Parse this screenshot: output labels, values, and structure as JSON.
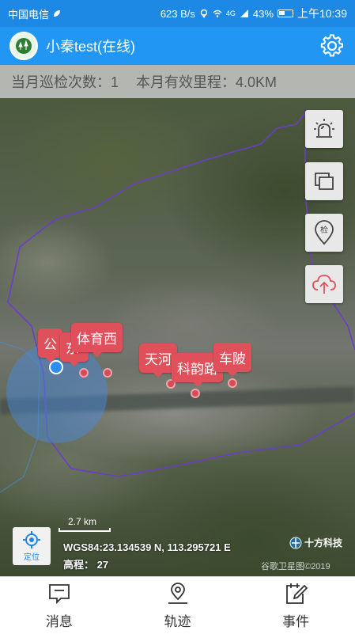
{
  "status_bar": {
    "carrier": "中国电信",
    "speed": "623 B/s",
    "network": "4G",
    "battery": "43%",
    "time": "上午10:39"
  },
  "app_bar": {
    "title": "小秦test(在线)",
    "settings_icon": "gear-icon"
  },
  "stats": {
    "patrol_count": "当月巡检次数：1",
    "mileage": "本月有效里程：4.0KM"
  },
  "map": {
    "markers": [
      {
        "label": "公",
        "icon": "location-pin"
      },
      {
        "label": "东",
        "icon": "location-pin"
      },
      {
        "label": "体育西",
        "icon": "location-pin"
      },
      {
        "label": "天河",
        "icon": "location-pin"
      },
      {
        "label": "科韵路",
        "icon": "location-pin"
      },
      {
        "label": "车陂",
        "icon": "location-pin"
      }
    ],
    "scale_label": "2.7 km",
    "locate_label": "定位",
    "coordinates": "WGS84:23.134539 N, 113.295721 E",
    "elevation": "高程： 27",
    "brand": "十方科技",
    "copyright": "谷歌卫星图©2019"
  },
  "tools": [
    {
      "name": "alarm",
      "icon": "siren-icon"
    },
    {
      "name": "layers",
      "icon": "layers-icon"
    },
    {
      "name": "inspect",
      "icon": "inspect-pin-icon",
      "label": "检"
    },
    {
      "name": "upload",
      "icon": "cloud-upload-icon"
    }
  ],
  "bottom_nav": {
    "items": [
      {
        "label": "消息",
        "icon": "message-icon"
      },
      {
        "label": "轨迹",
        "icon": "track-icon"
      },
      {
        "label": "事件",
        "icon": "event-icon"
      }
    ]
  },
  "colors": {
    "primary": "#2196f3",
    "marker": "#e0505a",
    "boundary": "#6a3fc8"
  }
}
